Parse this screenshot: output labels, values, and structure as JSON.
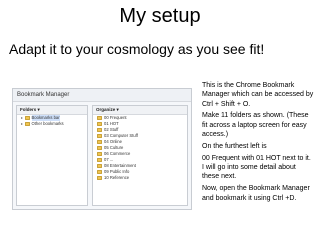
{
  "slide": {
    "title": "My setup",
    "subtitle": "Adapt it to your cosmology as you see fit!"
  },
  "bookmark_manager": {
    "window_title": "Bookmark Manager",
    "folders_header": "Folders ▾",
    "organize_header": "Organize ▾",
    "tree": [
      {
        "label": "Bookmarks bar",
        "selected": true
      },
      {
        "label": "Other bookmarks",
        "selected": false
      }
    ],
    "folders": [
      "00 Frequent",
      "01 HOT",
      "02 Stuff",
      "03 Computer Stuff",
      "04 Online",
      "05 Culture",
      "06 Commerce",
      "07 ...",
      "08 Entertainment",
      "09 Public Info",
      "10 Reference"
    ]
  },
  "notes": [
    "This is the Chrome Bookmark Manager which can be accessed by Ctrl + Shift + O.",
    "Make 11 folders as shown. (These fit across a laptop screen for easy access.)",
    "On the furthest left is",
    "00 Frequent with 01 HOT next to it. I will go into some detail about these next.",
    "Now, open the Bookmark Manager and bookmark it using Ctrl +D."
  ],
  "colors": {
    "folder": "#f1c54f",
    "selection": "#cfe0fa"
  },
  "icons": [
    "folder-icon",
    "caret-icon"
  ]
}
